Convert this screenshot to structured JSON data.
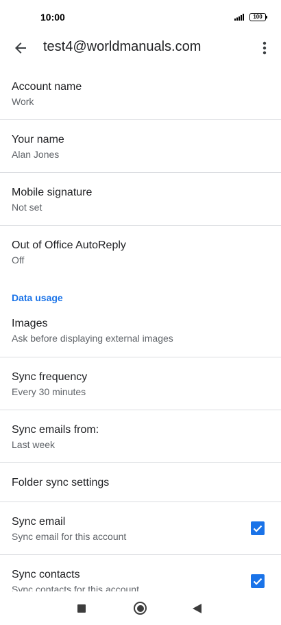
{
  "status_bar": {
    "time": "10:00",
    "battery": "100"
  },
  "app_bar": {
    "title": "test4@worldmanuals.com"
  },
  "settings": {
    "account_name": {
      "label": "Account name",
      "value": "Work"
    },
    "your_name": {
      "label": "Your name",
      "value": "Alan Jones"
    },
    "mobile_signature": {
      "label": "Mobile signature",
      "value": "Not set"
    },
    "out_of_office": {
      "label": "Out of Office AutoReply",
      "value": "Off"
    },
    "data_usage_header": "Data usage",
    "images": {
      "label": "Images",
      "value": "Ask before displaying external images"
    },
    "sync_frequency": {
      "label": "Sync frequency",
      "value": "Every 30 minutes"
    },
    "sync_emails_from": {
      "label": "Sync emails from:",
      "value": "Last week"
    },
    "folder_sync": {
      "label": "Folder sync settings"
    },
    "sync_email": {
      "label": "Sync email",
      "value": "Sync email for this account",
      "checked": true
    },
    "sync_contacts": {
      "label": "Sync contacts",
      "value": "Sync contacts for this account",
      "checked": true
    }
  },
  "colors": {
    "accent": "#1a73e8",
    "text_primary": "#202124",
    "text_secondary": "#5f6368",
    "divider": "#dadce0"
  },
  "icons": {
    "back": "arrow-back-icon",
    "more": "more-vert-icon",
    "checkbox": "check-icon"
  }
}
